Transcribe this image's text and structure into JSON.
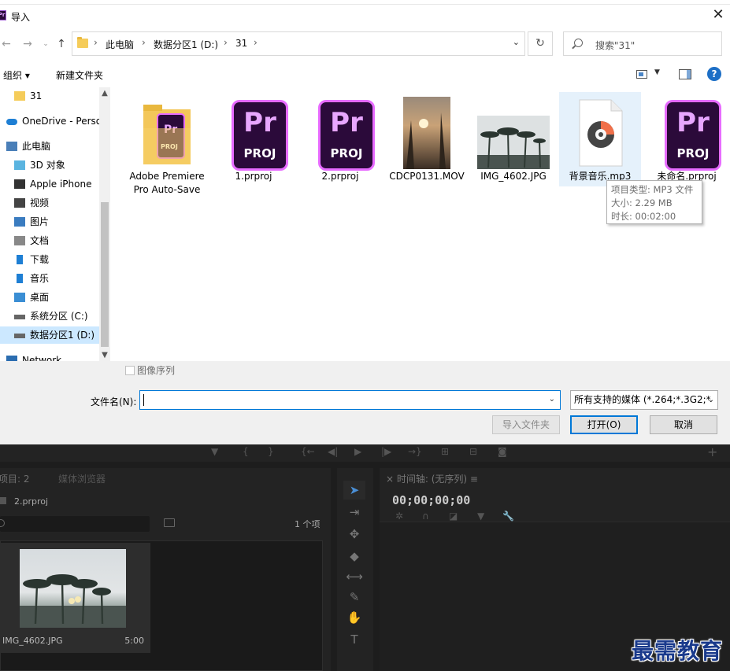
{
  "dialog": {
    "title": "导入",
    "address": {
      "crumbs": [
        "此电脑",
        "数据分区1 (D:)",
        "31"
      ]
    },
    "search_placeholder": "搜索\"31\"",
    "toolbar": {
      "organize": "组织 ▾",
      "new_folder": "新建文件夹"
    },
    "nav": [
      {
        "label": "31",
        "icon": "folder-icon"
      },
      {
        "label": "OneDrive - Perso",
        "icon": "cloud-icon"
      },
      {
        "label": "此电脑",
        "icon": "computer-icon"
      },
      {
        "label": "3D 对象",
        "icon": "cube-icon"
      },
      {
        "label": "Apple iPhone",
        "icon": "phone-icon"
      },
      {
        "label": "视频",
        "icon": "video-icon"
      },
      {
        "label": "图片",
        "icon": "picture-icon"
      },
      {
        "label": "文档",
        "icon": "document-icon"
      },
      {
        "label": "下载",
        "icon": "download-icon"
      },
      {
        "label": "音乐",
        "icon": "music-icon"
      },
      {
        "label": "桌面",
        "icon": "desktop-icon"
      },
      {
        "label": "系统分区 (C:)",
        "icon": "drive-icon"
      },
      {
        "label": "数据分区1 (D:)",
        "icon": "drive-icon"
      },
      {
        "label": "Network",
        "icon": "network-icon"
      }
    ],
    "files": [
      {
        "name": "Adobe Premiere Pro Auto-Save",
        "kind": "folder"
      },
      {
        "name": "1.prproj",
        "kind": "prproj"
      },
      {
        "name": "2.prproj",
        "kind": "prproj"
      },
      {
        "name": "CDCP0131.MOV",
        "kind": "video"
      },
      {
        "name": "IMG_4602.JPG",
        "kind": "image"
      },
      {
        "name": "背景音乐.mp3",
        "kind": "audio"
      },
      {
        "name": "未命名.prproj",
        "kind": "prproj"
      }
    ],
    "pr_icon_text": {
      "pr": "Pr",
      "proj": "PROJ"
    },
    "tooltip": {
      "type": "项目类型: MP3 文件",
      "size": "大小: 2.29 MB",
      "duration": "时长: 00:02:00"
    },
    "image_sequence_label": "图像序列",
    "filename_label": "文件名(N):",
    "filename_value": "",
    "filter_value": "所有支持的媒体 (*.264;*.3G2;*",
    "buttons": {
      "import_folder": "导入文件夹",
      "open": "打开(O)",
      "cancel": "取消"
    }
  },
  "premiere": {
    "project_tab": "项目: 2",
    "media_browser_tab": "媒体浏览器",
    "project_file": "2.prproj",
    "item_count": "1 个项",
    "clip": {
      "name": "IMG_4602.JPG",
      "duration": "5:00"
    },
    "timeline_tab": "× 时间轴: (无序列) ≡",
    "timecode": "00;00;00;00"
  },
  "watermark": "最需教育",
  "colors": {
    "accent": "#0078d7",
    "premiere_purple": "#e76bff",
    "premiere_bg": "#1d1d1d"
  }
}
